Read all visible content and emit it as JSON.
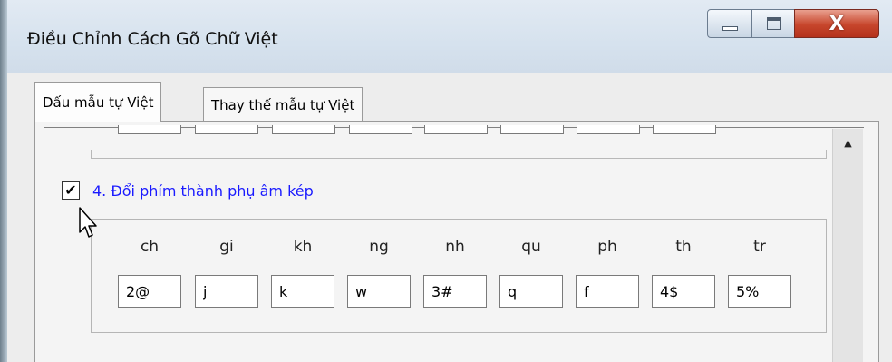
{
  "window": {
    "title": "Điều Chỉnh Cách Gõ Chữ Việt",
    "close_glyph": "X"
  },
  "tabs": [
    {
      "label": "Dấu mẫu tự Việt",
      "active": true
    },
    {
      "label": "Thay thế mẫu tự Việt",
      "active": false
    }
  ],
  "option4": {
    "checked": true,
    "check_glyph": "✔",
    "label": "4. Đổi phím thành phụ âm kép"
  },
  "mappings": [
    {
      "label": "ch",
      "value": "2@"
    },
    {
      "label": "gi",
      "value": "j"
    },
    {
      "label": "kh",
      "value": "k"
    },
    {
      "label": "ng",
      "value": "w"
    },
    {
      "label": "nh",
      "value": "3#"
    },
    {
      "label": "qu",
      "value": "q"
    },
    {
      "label": "ph",
      "value": "f"
    },
    {
      "label": "th",
      "value": "4$"
    },
    {
      "label": "tr",
      "value": "5%"
    }
  ],
  "scrollbar": {
    "up_glyph": "▲"
  },
  "colors": {
    "label_blue": "#1a1aff",
    "close_red": "#c7462c"
  },
  "icons": {
    "cursor": "arrow-cursor-icon"
  }
}
